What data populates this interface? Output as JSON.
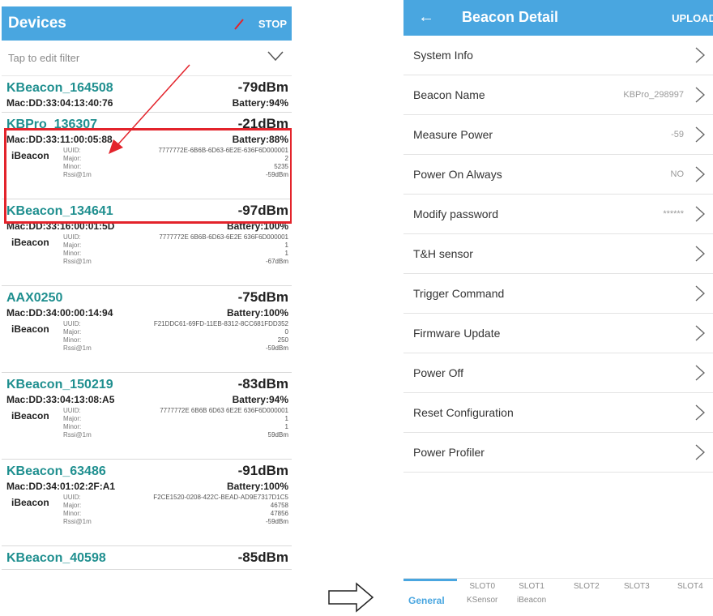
{
  "left_screen": {
    "title": "Devices",
    "stop_label": "STOP",
    "filter_hint": "Tap to edit filter",
    "devices": [
      {
        "name": "KBeacon_164508",
        "rssi": "-79dBm",
        "mac": "Mac:DD:33:04:13:40:76",
        "battery": "Battery:94%"
      },
      {
        "name": "KBPro_136307",
        "rssi": "-21dBm",
        "mac": "Mac:DD:33:11:00:05:88",
        "battery": "Battery:88%",
        "beacon": {
          "type": "iBeacon",
          "keys": [
            "UUID:",
            "Major:",
            "Minor:",
            "Rssi@1m"
          ],
          "values": [
            "7777772E-6B6B-6D63-6E2E-636F6D000001",
            "2",
            "5235",
            "-59dBm"
          ]
        }
      },
      {
        "name": "KBeacon_134641",
        "rssi": "-97dBm",
        "mac": "Mac:DD:33:16:00:01:5D",
        "battery": "Battery:100%",
        "beacon": {
          "type": "iBeacon",
          "keys": [
            "UUID:",
            "Major:",
            "Minor:",
            "Rssi@1m"
          ],
          "values": [
            "7777772E 6B6B-6D63-6E2E 636F6D000001",
            "1",
            "1",
            "-67dBm"
          ]
        }
      },
      {
        "name": "AAX0250",
        "rssi": "-75dBm",
        "mac": "Mac:DD:34:00:00:14:94",
        "battery": "Battery:100%",
        "beacon": {
          "type": "iBeacon",
          "keys": [
            "UUID:",
            "Major:",
            "Minor:",
            "Rssi@1m"
          ],
          "values": [
            "F21DDC61-69FD-11EB-8312-8CC681FDD352",
            "0",
            "250",
            "-59dBm"
          ]
        }
      },
      {
        "name": "KBeacon_150219",
        "rssi": "-83dBm",
        "mac": "Mac:DD:33:04:13:08:A5",
        "battery": "Battery:94%",
        "beacon": {
          "type": "iBeacon",
          "keys": [
            "UUID:",
            "Major:",
            "Minor:",
            "Rssi@1m"
          ],
          "values": [
            "7777772E 6B6B 6D63 6E2E 636F6D000001",
            "1",
            "1",
            "59dBm"
          ]
        }
      },
      {
        "name": "KBeacon_63486",
        "rssi": "-91dBm",
        "mac": "Mac:DD:34:01:02:2F:A1",
        "battery": "Battery:100%",
        "beacon": {
          "type": "iBeacon",
          "keys": [
            "UUID:",
            "Major:",
            "Minor:",
            "Rssi@1m"
          ],
          "values": [
            "F2CE1520-0208-422C-BEAD-AD9E7317D1C5",
            "46758",
            "47856",
            "-59dBm"
          ]
        }
      },
      {
        "name": "KBeacon_40598",
        "rssi": "-85dBm"
      }
    ]
  },
  "right_screen": {
    "title": "Beacon Detail",
    "upload_label": "UPLOAD",
    "menu": [
      {
        "label": "System Info",
        "value": ""
      },
      {
        "label": "Beacon Name",
        "value": "KBPro_298997"
      },
      {
        "label": "Measure Power",
        "value": "-59"
      },
      {
        "label": "Power On Always",
        "value": "NO"
      },
      {
        "label": "Modify password",
        "value": "******"
      },
      {
        "label": "T&H sensor",
        "value": ""
      },
      {
        "label": "Trigger Command",
        "value": ""
      },
      {
        "label": "Firmware Update",
        "value": ""
      },
      {
        "label": "Power Off",
        "value": ""
      },
      {
        "label": "Reset Configuration",
        "value": ""
      },
      {
        "label": "Power Profiler",
        "value": ""
      }
    ],
    "tabs": {
      "general": "General",
      "slot0": "SLOT0",
      "slot0_sub": "KSensor",
      "slot1": "SLOT1",
      "slot1_sub": "iBeacon",
      "slot2": "SLOT2",
      "slot3": "SLOT3",
      "slot4": "SLOT4"
    }
  },
  "colors": {
    "header": "#49a6e0",
    "device_name": "#1f8f8f",
    "highlight": "#e3232b"
  }
}
